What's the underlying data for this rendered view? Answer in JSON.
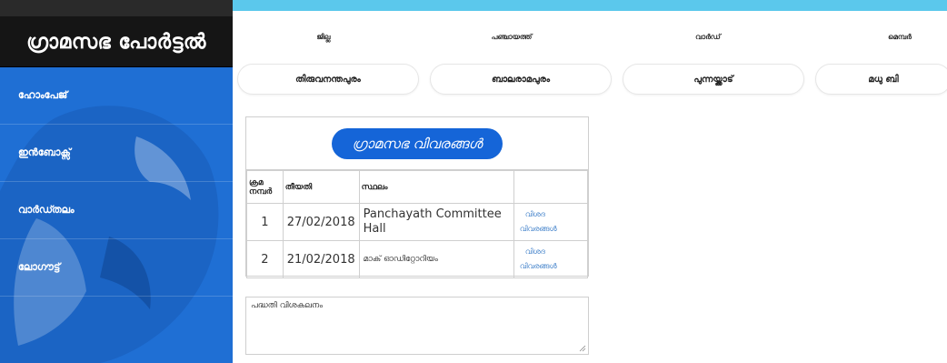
{
  "sidebar": {
    "brand": "ഗ്രാമസഭ പോർട്ടൽ",
    "items": [
      {
        "label": "ഹോംപേജ്"
      },
      {
        "label": "ഇൻബോക്സ്"
      },
      {
        "label": "വാർഡ്തലം"
      },
      {
        "label": "ലോഗൗട്ട്"
      }
    ]
  },
  "header": {
    "labels": {
      "district": "ജില്ല",
      "panchayat": "പഞ്ചായത്ത്",
      "ward": "വാർഡ്",
      "member": "മെമ്പർ"
    },
    "values": {
      "district": "തിരുവനന്തപുരം",
      "panchayat": "ബാലരാമപുരം",
      "ward": "പുന്നയ്ക്കാട്",
      "member": "മധു ബി"
    }
  },
  "gramasabha": {
    "title": "ഗ്രാമസഭ വിവരങ്ങൾ",
    "columns": [
      "ക്രമ നമ്പർ",
      "തീയതി",
      "സ്ഥലം",
      ""
    ],
    "rows": [
      {
        "no": "1",
        "date": "27/02/2018",
        "place": "Panchayath Committee Hall",
        "link1": "വിശദ",
        "link2": "വിവരങ്ങൾ"
      },
      {
        "no": "2",
        "date": "21/02/2018",
        "place": "മാക് ഓഡിറ്റോറിയം",
        "link1": "വിശദ",
        "link2": "വിവരങ്ങൾ"
      }
    ]
  },
  "notes": {
    "placeholder": "പദ്ധതി വിശകലനം"
  },
  "colors": {
    "sidebar": "#1f6fd4",
    "topbar": "#5bc8ec",
    "title_button": "#1565d8",
    "link": "#3b7dc8"
  }
}
